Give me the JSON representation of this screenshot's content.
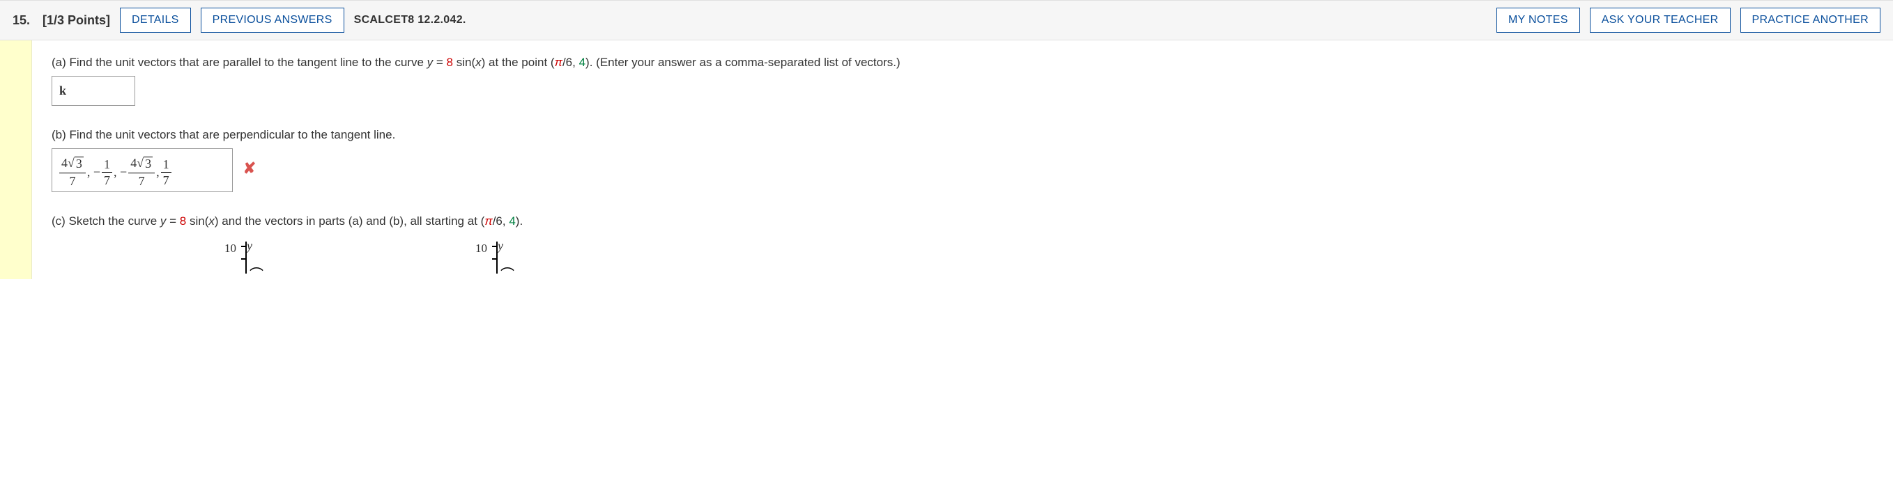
{
  "header": {
    "number": "15.",
    "points": "[1/3 Points]",
    "details_btn": "DETAILS",
    "prev_btn": "PREVIOUS ANSWERS",
    "reference": "SCALCET8 12.2.042.",
    "mynotes_btn": "MY NOTES",
    "ask_btn": "ASK YOUR TEACHER",
    "practice_btn": "PRACTICE ANOTHER"
  },
  "partA": {
    "text1": "(a) Find the unit vectors that are parallel to the tangent line to the curve ",
    "eq_y": "y",
    "eq_eq": " = ",
    "eq_coeff": "8",
    "eq_sin": " sin(",
    "eq_x": "x",
    "eq_close": ")",
    "text2": "  at the point (",
    "pi": "π",
    "text3": "/6, ",
    "four": "4",
    "text4": "). (Enter your answer as a comma-separated list of vectors.)",
    "answer": "k"
  },
  "partB": {
    "text": "(b) Find the unit vectors that are perpendicular to the tangent line.",
    "answer_num1_a": "4",
    "answer_num1_b": "3",
    "answer_den1": "7",
    "sep1": ", −",
    "answer_num2": "1",
    "answer_den2": "7",
    "sep2": ", −",
    "answer_num3_a": "4",
    "answer_num3_b": "3",
    "answer_den3": "7",
    "sep3": ", ",
    "answer_num4": "1",
    "answer_den4": "7",
    "mark": "✘"
  },
  "partC": {
    "text1": "(c) Sketch the curve ",
    "eq_y": "y",
    "eq_eq": " = ",
    "eq_coeff": "8",
    "eq_sin": " sin(",
    "eq_x": "x",
    "eq_close": ")",
    "text2": "  and the vectors in parts (a) and (b), all starting at (",
    "pi": "π",
    "text3": "/6, ",
    "four": "4",
    "text4": ").",
    "ylabel": "y",
    "yscale": "10"
  }
}
